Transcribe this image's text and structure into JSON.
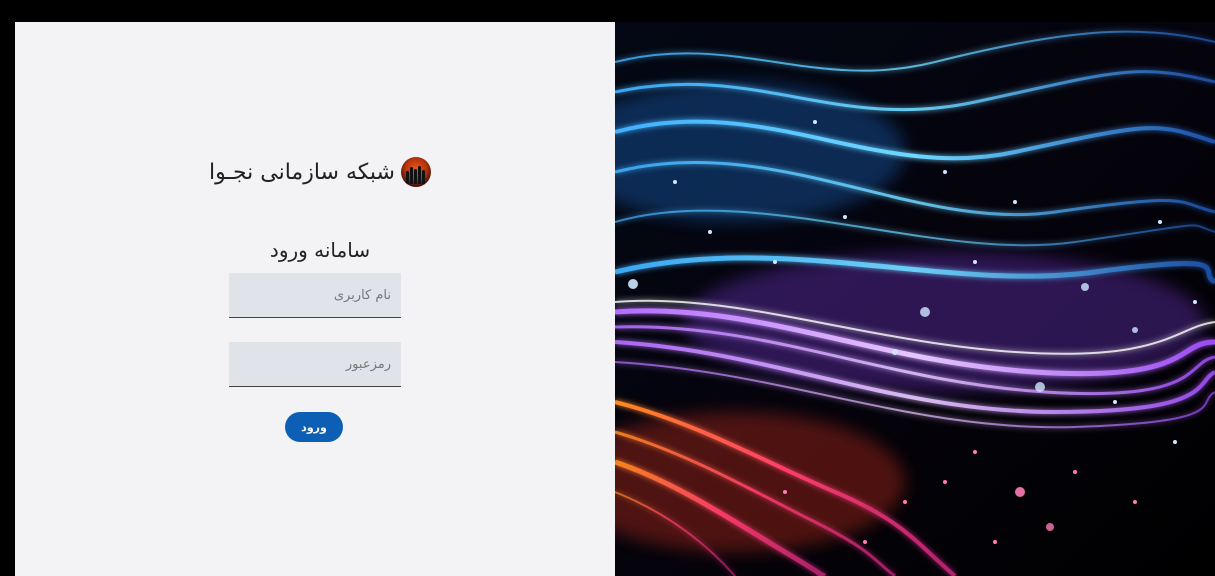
{
  "brand": {
    "title": "شبکه سازمانی نجـوا",
    "logo_icon": "team-silhouette-logo"
  },
  "login": {
    "heading": "سامانه ورود",
    "username_placeholder": "نام کاربری",
    "password_placeholder": "رمزعبور",
    "submit_label": "ورود"
  },
  "theme": {
    "panel_bg": "#f3f3f5",
    "field_bg": "#e1e3ea",
    "button_color": "#0d5fb5"
  }
}
